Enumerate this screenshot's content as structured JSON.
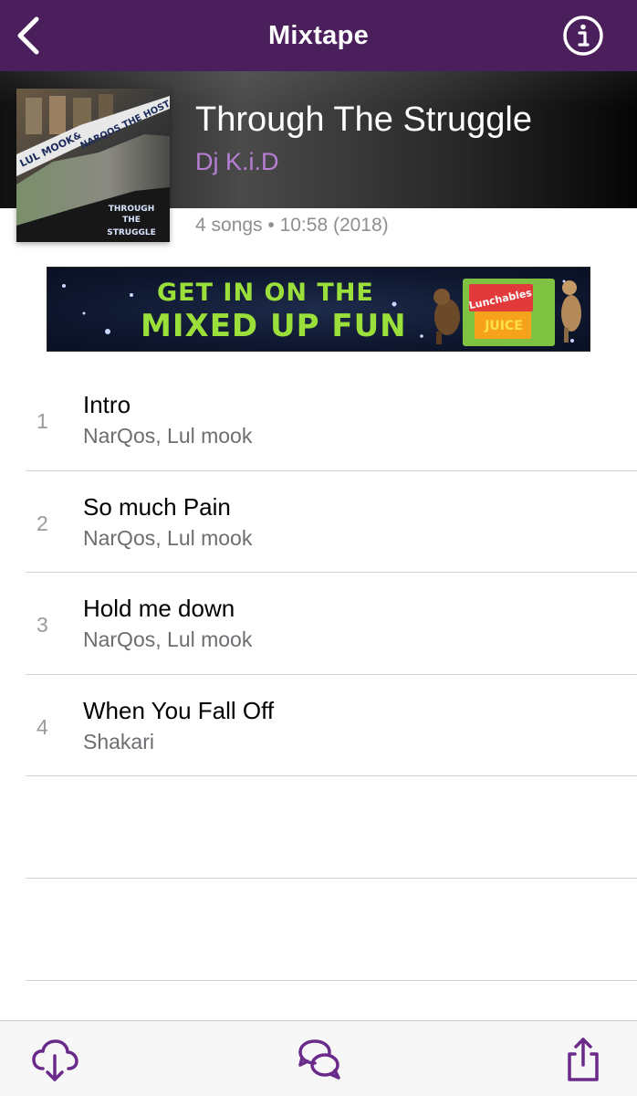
{
  "nav": {
    "title": "Mixtape"
  },
  "album": {
    "title": "Through The Struggle",
    "artist": "Dj K.i.D",
    "meta": "4 songs • 10:58 (2018)",
    "cover_text": [
      "LUL MOOK",
      "&",
      "NARQOS THE HOST",
      "THROUGH",
      "THE",
      "STRUGGLE"
    ]
  },
  "ad": {
    "line1": "GET IN ON THE",
    "line2": "MIXED UP FUN",
    "brand": "Lunchables",
    "product": "JUICE"
  },
  "tracks": [
    {
      "num": "1",
      "title": "Intro",
      "artist": "NarQos, Lul mook"
    },
    {
      "num": "2",
      "title": "So much Pain",
      "artist": "NarQos, Lul mook"
    },
    {
      "num": "3",
      "title": "Hold me down",
      "artist": "NarQos, Lul mook"
    },
    {
      "num": "4",
      "title": "When You Fall Off",
      "artist": "Shakari"
    }
  ],
  "icons": {
    "back": "chevron-left-icon",
    "info": "info-icon",
    "download": "cloud-download-icon",
    "comments": "chat-bubbles-icon",
    "share": "share-icon"
  },
  "colors": {
    "nav_bg": "#4a1f5c",
    "accent": "#6a2a8a",
    "artist": "#b67ed4"
  }
}
